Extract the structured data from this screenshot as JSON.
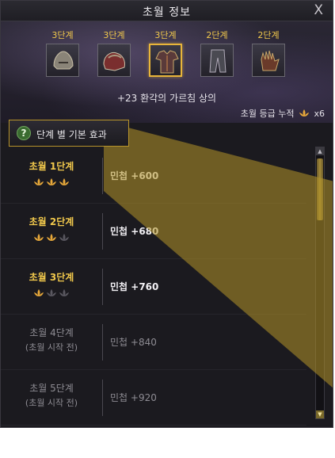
{
  "window": {
    "title": "초월 정보",
    "close_label": "X"
  },
  "equipment": [
    {
      "stage": "3단계",
      "icon": "helmet-icon",
      "selected": false
    },
    {
      "stage": "3단계",
      "icon": "shoulder-armor-icon",
      "selected": false
    },
    {
      "stage": "3단계",
      "icon": "chest-armor-icon",
      "selected": true
    },
    {
      "stage": "2단계",
      "icon": "leg-armor-icon",
      "selected": false
    },
    {
      "stage": "2단계",
      "icon": "gloves-icon",
      "selected": false
    }
  ],
  "item_name": "+23 환각의 가르침 상의",
  "cumulative": {
    "label": "초월 등급 누적",
    "value": "x6"
  },
  "effects_button": {
    "label": "단계 별 기본 효과",
    "icon_text": "?"
  },
  "stages": [
    {
      "name": "초월 1단계",
      "sub": "",
      "lotus_filled": 3,
      "effect": "민첩 +600",
      "active": true
    },
    {
      "name": "초월 2단계",
      "sub": "",
      "lotus_filled": 2,
      "effect": "민첩 +680",
      "active": true
    },
    {
      "name": "초월 3단계",
      "sub": "",
      "lotus_filled": 1,
      "effect": "민첩 +760",
      "active": true
    },
    {
      "name": "초월 4단계",
      "sub": "(초월 시작 전)",
      "lotus_filled": 0,
      "effect": "민첩 +840",
      "active": false
    },
    {
      "name": "초월 5단계",
      "sub": "(초월 시작 전)",
      "lotus_filled": 0,
      "effect": "민첩 +920",
      "active": false
    }
  ],
  "colors": {
    "gold": "#f2c94c",
    "muted": "#8e8c93",
    "lotus_filled": "#e8a93a",
    "lotus_empty": "#5a5860"
  }
}
